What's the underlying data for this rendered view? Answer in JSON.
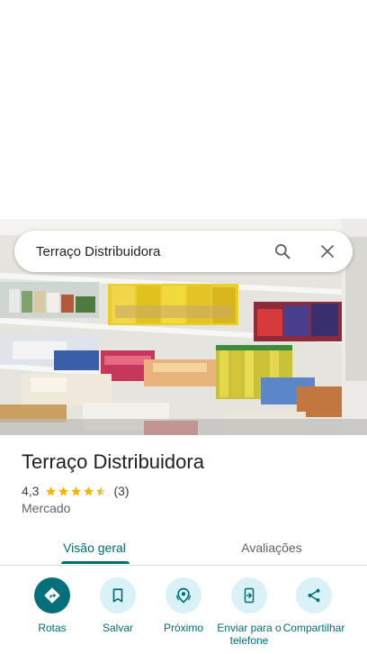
{
  "search": {
    "query": "Terraço Distribuidora"
  },
  "place": {
    "name": "Terraço Distribuidora",
    "rating": "4,3",
    "rating_value": 4.3,
    "review_count": "(3)",
    "category": "Mercado"
  },
  "tabs": [
    {
      "label": "Visão geral",
      "active": true
    },
    {
      "label": "Avaliações",
      "active": false
    }
  ],
  "actions": [
    {
      "label": "Rotas",
      "icon": "directions-icon"
    },
    {
      "label": "Salvar",
      "icon": "bookmark-icon"
    },
    {
      "label": "Próximo",
      "icon": "nearby-icon"
    },
    {
      "label": "Enviar para o telefone",
      "icon": "send-to-phone-icon"
    },
    {
      "label": "Compartilhar",
      "icon": "share-icon"
    }
  ],
  "colors": {
    "accent": "#006c74",
    "primary_button": "#03707a",
    "secondary_button_bg": "#d8f2f7",
    "star": "#f4b400"
  }
}
